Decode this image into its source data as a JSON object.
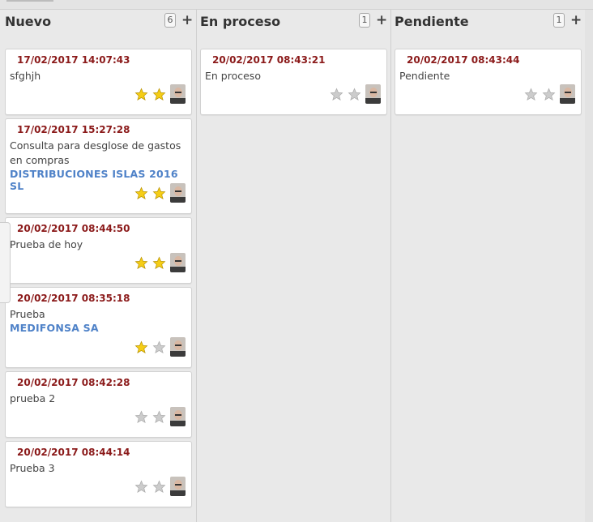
{
  "columns": [
    {
      "title": "Nuevo",
      "count": "6",
      "add_label": "+",
      "cards": [
        {
          "date": "17/02/2017 14:07:43",
          "title": "sfghjh",
          "partner": "",
          "stars": 2
        },
        {
          "date": "17/02/2017 15:27:28",
          "title": "Consulta para desglose de gastos en compras",
          "partner": "DISTRIBUCIONES ISLAS 2016 SL",
          "stars": 2
        },
        {
          "date": "20/02/2017 08:44:50",
          "title": "Prueba de hoy",
          "partner": "",
          "stars": 2
        },
        {
          "date": "20/02/2017 08:35:18",
          "title": "Prueba",
          "partner": "MEDIFONSA SA",
          "stars": 1
        },
        {
          "date": "20/02/2017 08:42:28",
          "title": "prueba 2",
          "partner": "",
          "stars": 0
        },
        {
          "date": "20/02/2017 08:44:14",
          "title": "Prueba 3",
          "partner": "",
          "stars": 0
        }
      ]
    },
    {
      "title": "En proceso",
      "count": "1",
      "add_label": "+",
      "cards": [
        {
          "date": "20/02/2017 08:43:21",
          "title": "En proceso",
          "partner": "",
          "stars": 0
        }
      ]
    },
    {
      "title": "Pendiente",
      "count": "1",
      "add_label": "+",
      "cards": [
        {
          "date": "20/02/2017 08:43:44",
          "title": "Pendiente",
          "partner": "",
          "stars": 0
        }
      ]
    }
  ],
  "colors": {
    "date_text": "#8b1a1a",
    "partner_link": "#4f82c8",
    "star_active": "#f5cd16",
    "star_inactive": "#cccccc",
    "background": "#e9e9e9"
  },
  "icons": {
    "priority_star": "star-icon",
    "assigned_user": "user-avatar-icon",
    "add_card": "plus-icon"
  }
}
